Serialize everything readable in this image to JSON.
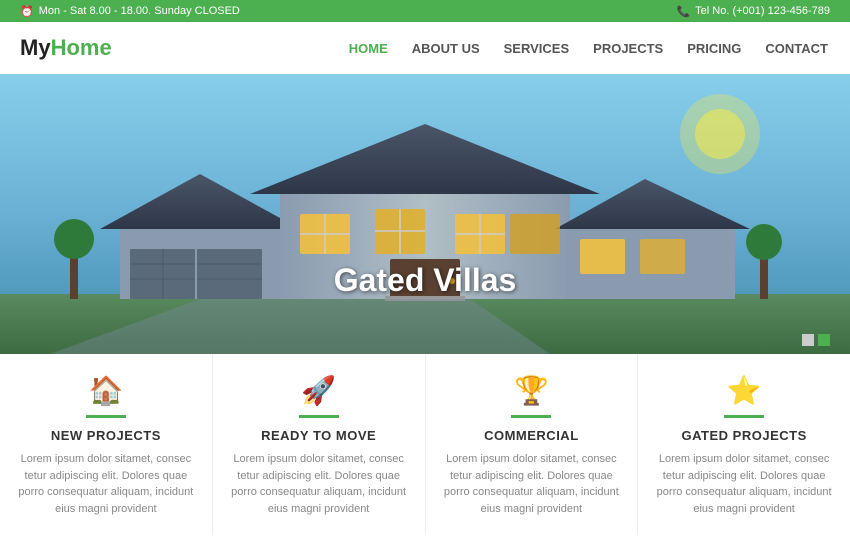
{
  "topbar": {
    "hours": "Mon - Sat 8.00 - 18.00. Sunday CLOSED",
    "phone": "Tel No. (+001) 123-456-789"
  },
  "header": {
    "logo_my": "My",
    "logo_home": "Home",
    "nav": [
      {
        "label": "HOME",
        "active": true
      },
      {
        "label": "ABOUT US",
        "active": false
      },
      {
        "label": "SERVICES",
        "active": false
      },
      {
        "label": "PROJECTS",
        "active": false
      },
      {
        "label": "PRICING",
        "active": false
      },
      {
        "label": "CONTACT",
        "active": false
      }
    ]
  },
  "hero": {
    "title": "Gated Villas",
    "dots": [
      true,
      false
    ]
  },
  "cards": [
    {
      "icon": "🏠",
      "title": "NEW PROJECTS",
      "text": "Lorem ipsum dolor sitamet, consec tetur adipiscing elit. Dolores quae porro consequatur aliquam, incidunt eius magni provident"
    },
    {
      "icon": "🚀",
      "title": "READY TO MOVE",
      "text": "Lorem ipsum dolor sitamet, consec tetur adipiscing elit. Dolores quae porro consequatur aliquam, incidunt eius magni provident"
    },
    {
      "icon": "🏆",
      "title": "COMMERCIAL",
      "text": "Lorem ipsum dolor sitamet, consec tetur adipiscing elit. Dolores quae porro consequatur aliquam, incidunt eius magni provident"
    },
    {
      "icon": "⭐",
      "title": "GATED PROJECTS",
      "text": "Lorem ipsum dolor sitamet, consec tetur adipiscing elit. Dolores quae porro consequatur aliquam, incidunt eius magni provident"
    }
  ],
  "colors": {
    "green": "#4caf50",
    "dark": "#333",
    "light_gray": "#888"
  }
}
